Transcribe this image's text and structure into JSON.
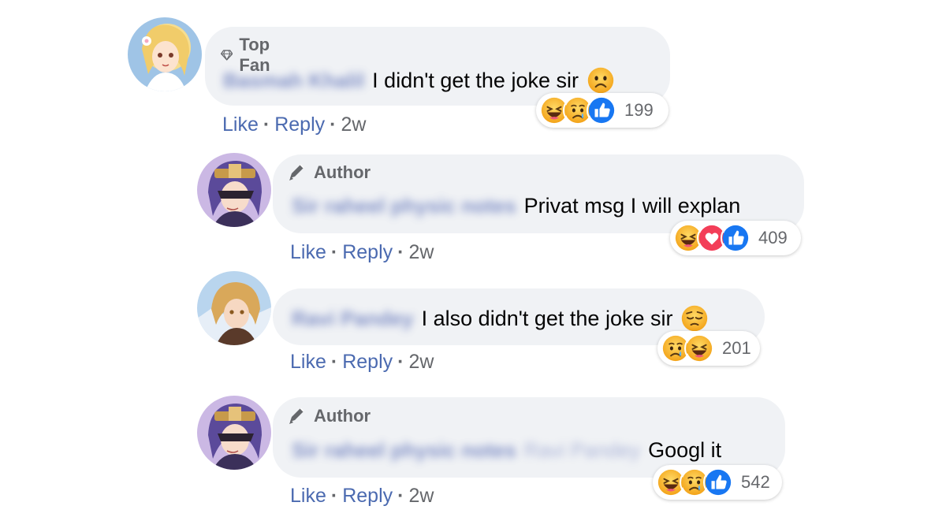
{
  "comments": [
    {
      "badge": "Top Fan",
      "badge_icon": "diamond-icon",
      "author_blurred": "Basmah Khalil",
      "text": "I didn't get the joke sir",
      "inline_emoji": "frowning-face-emoji",
      "reactions": [
        "haha",
        "sad",
        "like"
      ],
      "reaction_count": "199",
      "like": "Like",
      "reply": "Reply",
      "time": "2w"
    },
    {
      "badge": "Author",
      "badge_icon": "pencil-icon",
      "author_blurred": "Sir raheel physic notes",
      "text": "Privat msg I will explan",
      "reactions": [
        "haha",
        "love",
        "like"
      ],
      "reaction_count": "409",
      "like": "Like",
      "reply": "Reply",
      "time": "2w"
    },
    {
      "author_blurred": "Ravi Pandey",
      "text": "I also didn't get the joke sir",
      "inline_emoji": "pensive-face-emoji",
      "reactions": [
        "sad",
        "haha"
      ],
      "reaction_count": "201",
      "like": "Like",
      "reply": "Reply",
      "time": "2w"
    },
    {
      "badge": "Author",
      "badge_icon": "pencil-icon",
      "author_blurred": "Sir raheel physic notes",
      "mention_blurred": "Ravi Pandey",
      "text": "Googl it",
      "reactions": [
        "haha",
        "sad",
        "like"
      ],
      "reaction_count": "542",
      "like": "Like",
      "reply": "Reply",
      "time": "2w"
    }
  ],
  "colors": {
    "bubble": "#f0f2f5",
    "action_link": "#4b6ab0",
    "meta": "#65676b",
    "like_blue": "#1877f2",
    "love_red": "#f33e58",
    "emoji_yellow": "#f7b125"
  }
}
